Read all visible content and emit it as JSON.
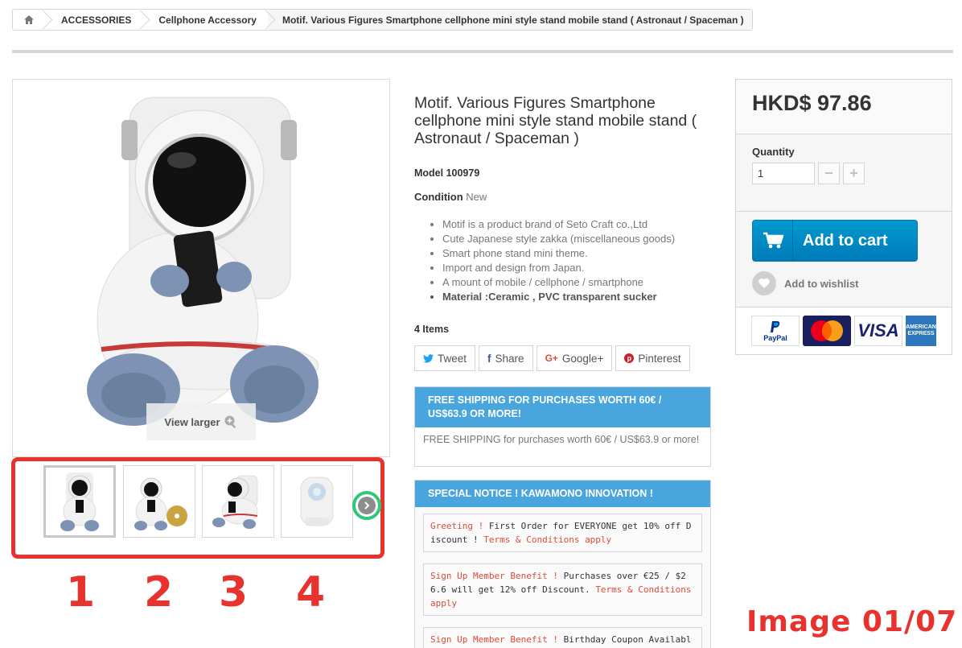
{
  "breadcrumb": {
    "level1": "ACCESSORIES",
    "level2": "Cellphone Accessory",
    "current": "Motif. Various Figures Smartphone cellphone mini style stand mobile stand ( Astronaut / Spaceman )"
  },
  "gallery": {
    "view_larger": "View larger",
    "thumb_numbers": [
      "1",
      "2",
      "3",
      "4"
    ],
    "caption": "Image 01/07"
  },
  "product": {
    "title": "Motif. Various Figures Smartphone cellphone mini style stand mobile stand ( Astronaut / Spaceman )",
    "model": "Model 100979",
    "condition_label": "Condition",
    "condition_value": "New",
    "features": [
      "Motif is a product brand of Seto Craft co.,Ltd",
      "Cute Japanese style zakka (miscellaneous goods)",
      "Smart phone stand mini theme.",
      "Import and design from Japan.",
      "A mount of mobile / cellphone / smartphone",
      "Material :Ceramic , PVC transparent sucker"
    ],
    "items_count": "4 Items"
  },
  "share": {
    "tweet": "Tweet",
    "facebook": "Share",
    "google": "Google+",
    "pinterest": "Pinterest"
  },
  "shipping_panel": {
    "heading": "FREE SHIPPING FOR PURCHASES WORTH 60€ / US$63.9 OR MORE!",
    "body": "FREE SHIPPING for purchases worth 60€ / US$63.9 or more!"
  },
  "notice_panel": {
    "heading": "SPECIAL NOTICE ! KAWAMONO INNOVATION !",
    "card1": {
      "a": "Greeting !",
      "b": " First Order for EVERYONE get 10% off Discount ! ",
      "c": "Terms & Conditions apply"
    },
    "card2": {
      "a": "Sign Up Member Benefit !",
      "b": " Purchases over €25 / $26.6 will get 12% off Discount. ",
      "c": "Terms & Conditions apply"
    },
    "card3": {
      "a": "Sign Up Member Benefit !",
      "b": " Birthday Coupon Availabl"
    }
  },
  "buy": {
    "price": "HKD$ 97.86",
    "quantity_label": "Quantity",
    "quantity_value": "1",
    "add_to_cart": "Add to cart",
    "wishlist": "Add to wishlist"
  },
  "payments": {
    "paypal": "PayPal",
    "visa": "VISA",
    "amex": "AMERICAN EXPRESS"
  },
  "colors": {
    "accent": "#48a5de",
    "cart_button": "#0089c8",
    "highlight_red": "#e8322e",
    "next_ring": "#2dc87a"
  }
}
